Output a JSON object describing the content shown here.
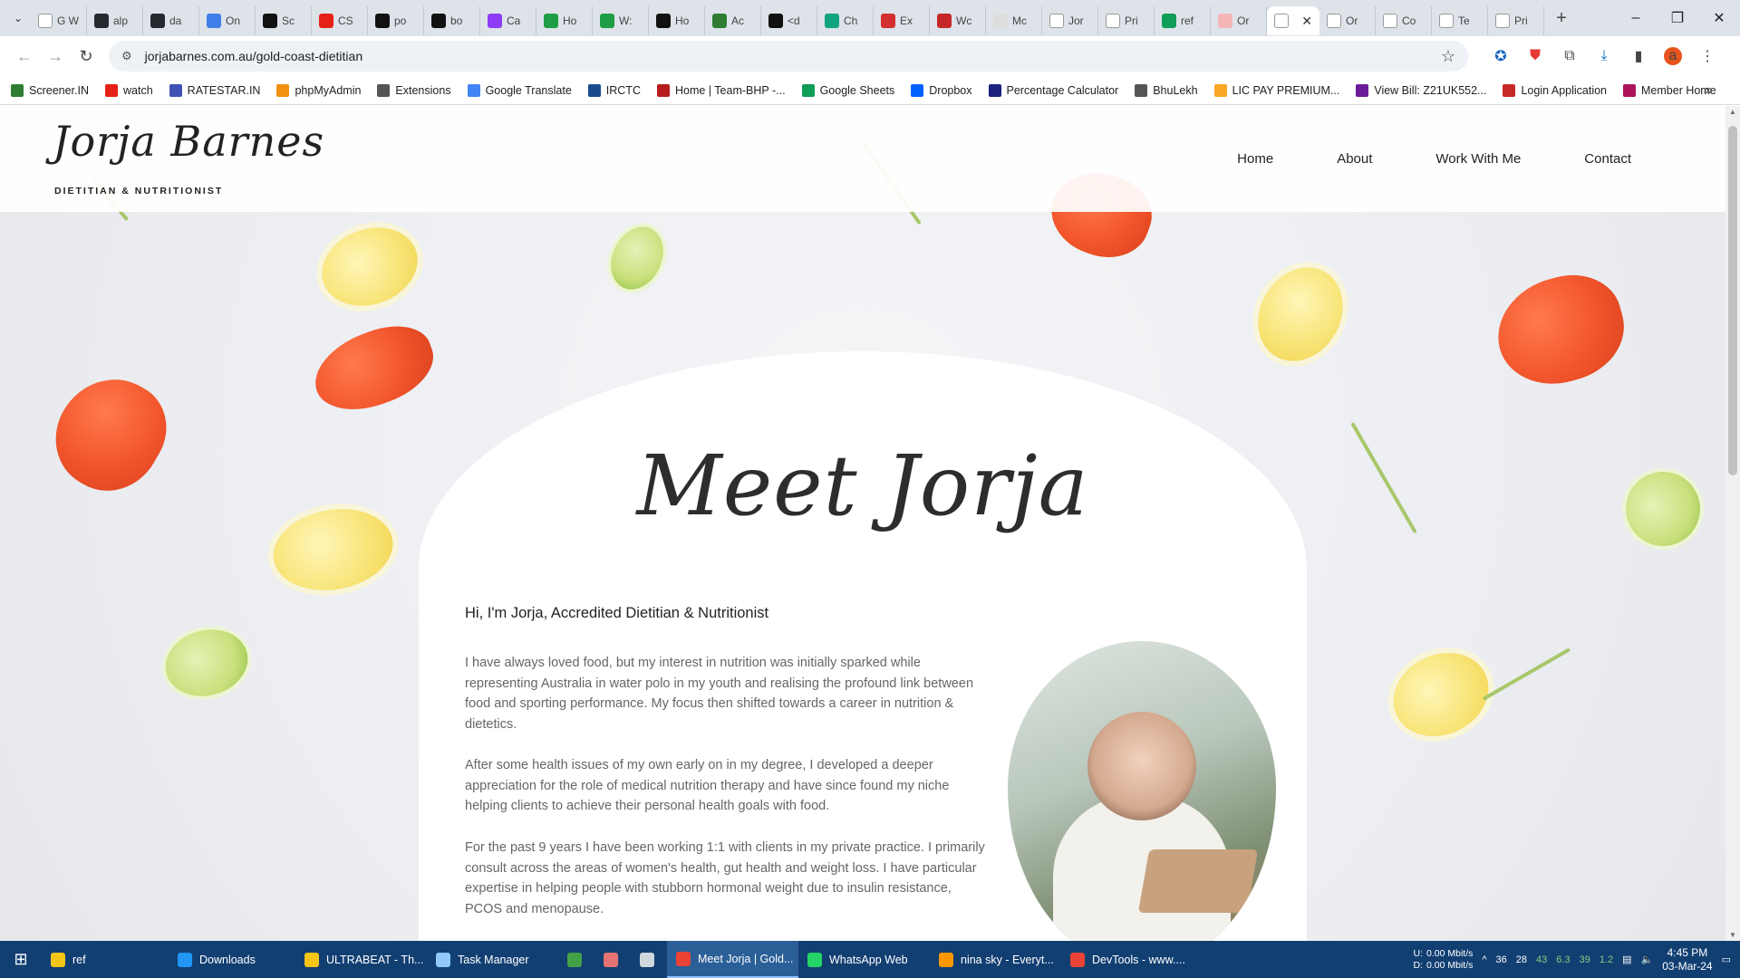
{
  "browser": {
    "tabs": [
      {
        "label": "G W",
        "color": "#ffffff",
        "icon": "google-icon"
      },
      {
        "label": "alp",
        "color": "#24292e",
        "icon": "github-icon"
      },
      {
        "label": "da",
        "color": "#24292e",
        "icon": "github-icon"
      },
      {
        "label": "On",
        "color": "#3f7ee8",
        "icon": "on-icon"
      },
      {
        "label": "Sc",
        "color": "#111111",
        "icon": "s-icon"
      },
      {
        "label": "CS",
        "color": "#e62117",
        "icon": "youtube-icon"
      },
      {
        "label": "po",
        "color": "#111111",
        "icon": "m-icon"
      },
      {
        "label": "bo",
        "color": "#111111",
        "icon": "m-icon"
      },
      {
        "label": "Ca",
        "color": "#8e3cf7",
        "icon": "b-icon"
      },
      {
        "label": "Ho",
        "color": "#1f9d44",
        "icon": "w-icon"
      },
      {
        "label": "W:",
        "color": "#1f9d44",
        "icon": "w-icon"
      },
      {
        "label": "Ho",
        "color": "#111111",
        "icon": "a-icon"
      },
      {
        "label": "Ac",
        "color": "#2e7d32",
        "icon": "chain-icon"
      },
      {
        "label": "<d",
        "color": "#111111",
        "icon": "m-icon"
      },
      {
        "label": "Ch",
        "color": "#10a37f",
        "icon": "chatgpt-icon"
      },
      {
        "label": "Ex",
        "color": "#d32f2f",
        "icon": "pdf-icon"
      },
      {
        "label": "Wc",
        "color": "#c62828",
        "icon": "flag-icon"
      },
      {
        "label": "Mc",
        "color": "#dddddd",
        "icon": "cloud-icon"
      },
      {
        "label": "Jor",
        "color": "#ffffff",
        "icon": "jb-icon"
      },
      {
        "label": "Pri",
        "color": "#ffffff",
        "icon": "w-serif-icon"
      },
      {
        "label": "ref",
        "color": "#0f9d58",
        "icon": "sheets-icon"
      },
      {
        "label": "Or",
        "color": "#f4b6b6",
        "icon": "a-doc-icon"
      },
      {
        "label": "",
        "color": "#ffffff",
        "icon": "jb-icon",
        "active": true
      },
      {
        "label": "Or",
        "color": "#ffffff",
        "icon": "jb-icon"
      },
      {
        "label": "Co",
        "color": "#ffffff",
        "icon": "jb-icon"
      },
      {
        "label": "Te",
        "color": "#ffffff",
        "icon": "jb-icon"
      },
      {
        "label": "Pri",
        "color": "#ffffff",
        "icon": "jb-icon"
      }
    ],
    "url": "jorjabarnes.com.au/gold-coast-dietitian",
    "profile_initial": "a",
    "bookmarks": [
      {
        "label": "Screener.IN",
        "color": "#2e7d32"
      },
      {
        "label": "watch",
        "color": "#e62117"
      },
      {
        "label": "RATESTAR.IN",
        "color": "#3f51b5"
      },
      {
        "label": "phpMyAdmin",
        "color": "#f29111"
      },
      {
        "label": "Extensions",
        "color": "#555555"
      },
      {
        "label": "Google Translate",
        "color": "#4285f4"
      },
      {
        "label": "IRCTC",
        "color": "#1a4b8c"
      },
      {
        "label": "Home | Team-BHP -...",
        "color": "#b71c1c"
      },
      {
        "label": "Google Sheets",
        "color": "#0f9d58"
      },
      {
        "label": "Dropbox",
        "color": "#0061ff"
      },
      {
        "label": "Percentage Calculator",
        "color": "#1a237e"
      },
      {
        "label": "BhuLekh",
        "color": "#555555"
      },
      {
        "label": "LIC PAY PREMIUM...",
        "color": "#f9a825"
      },
      {
        "label": "View Bill: Z21UK552...",
        "color": "#6a1b9a"
      },
      {
        "label": "Login Application",
        "color": "#c62828"
      },
      {
        "label": "Member Home",
        "color": "#ad1457"
      }
    ]
  },
  "site": {
    "logo": "Jorja Barnes",
    "tagline": "DIETITIAN & NUTRITIONIST",
    "nav": [
      "Home",
      "About",
      "Work With Me",
      "Contact"
    ],
    "heading": "Meet Jorja",
    "intro_title": "Hi, I'm Jorja, Accredited Dietitian & Nutritionist",
    "paragraphs": [
      "I have always loved food, but my interest in nutrition was initially sparked while representing Australia in water polo in my youth and realising the profound link between food and sporting performance. My focus then shifted towards a career in nutrition & dietetics.",
      "After some health issues of my own early on in my degree, I developed a deeper appreciation for the role of medical nutrition therapy and have since found my niche helping clients to achieve their personal health goals with food.",
      "For the past 9 years I have been working 1:1 with clients in my private practice. I primarily consult across the areas of women's health, gut health and weight loss. I have particular expertise in helping people with stubborn hormonal weight due to insulin resistance, PCOS and menopause."
    ]
  },
  "taskbar": {
    "tasks": [
      {
        "label": "ref",
        "color": "#f5c518"
      },
      {
        "label": "Downloads",
        "color": "#2196f3"
      },
      {
        "label": "ULTRABEAT - Th...",
        "color": "#f5c518"
      },
      {
        "label": "Task Manager",
        "color": "#90caf9"
      },
      {
        "label": "",
        "color": "#43a047"
      },
      {
        "label": "",
        "color": "#e57373"
      },
      {
        "label": "",
        "color": "#cfd8dc"
      },
      {
        "label": "Meet Jorja | Gold...",
        "color": "#ea4335",
        "active": true
      },
      {
        "label": "WhatsApp Web",
        "color": "#25d366"
      },
      {
        "label": "nina sky - Everyt...",
        "color": "#ff9800"
      },
      {
        "label": "DevTools - www....",
        "color": "#ea4335"
      }
    ],
    "net_up_label": "U:",
    "net_down_label": "D:",
    "net_up": "0.00 Mbit/s",
    "net_down": "0.00 Mbit/s",
    "tray_numbers": [
      "36",
      "28",
      "43",
      "6.3",
      "39",
      "1.2"
    ],
    "time": "4:45 PM",
    "date": "03-Mar-24"
  }
}
